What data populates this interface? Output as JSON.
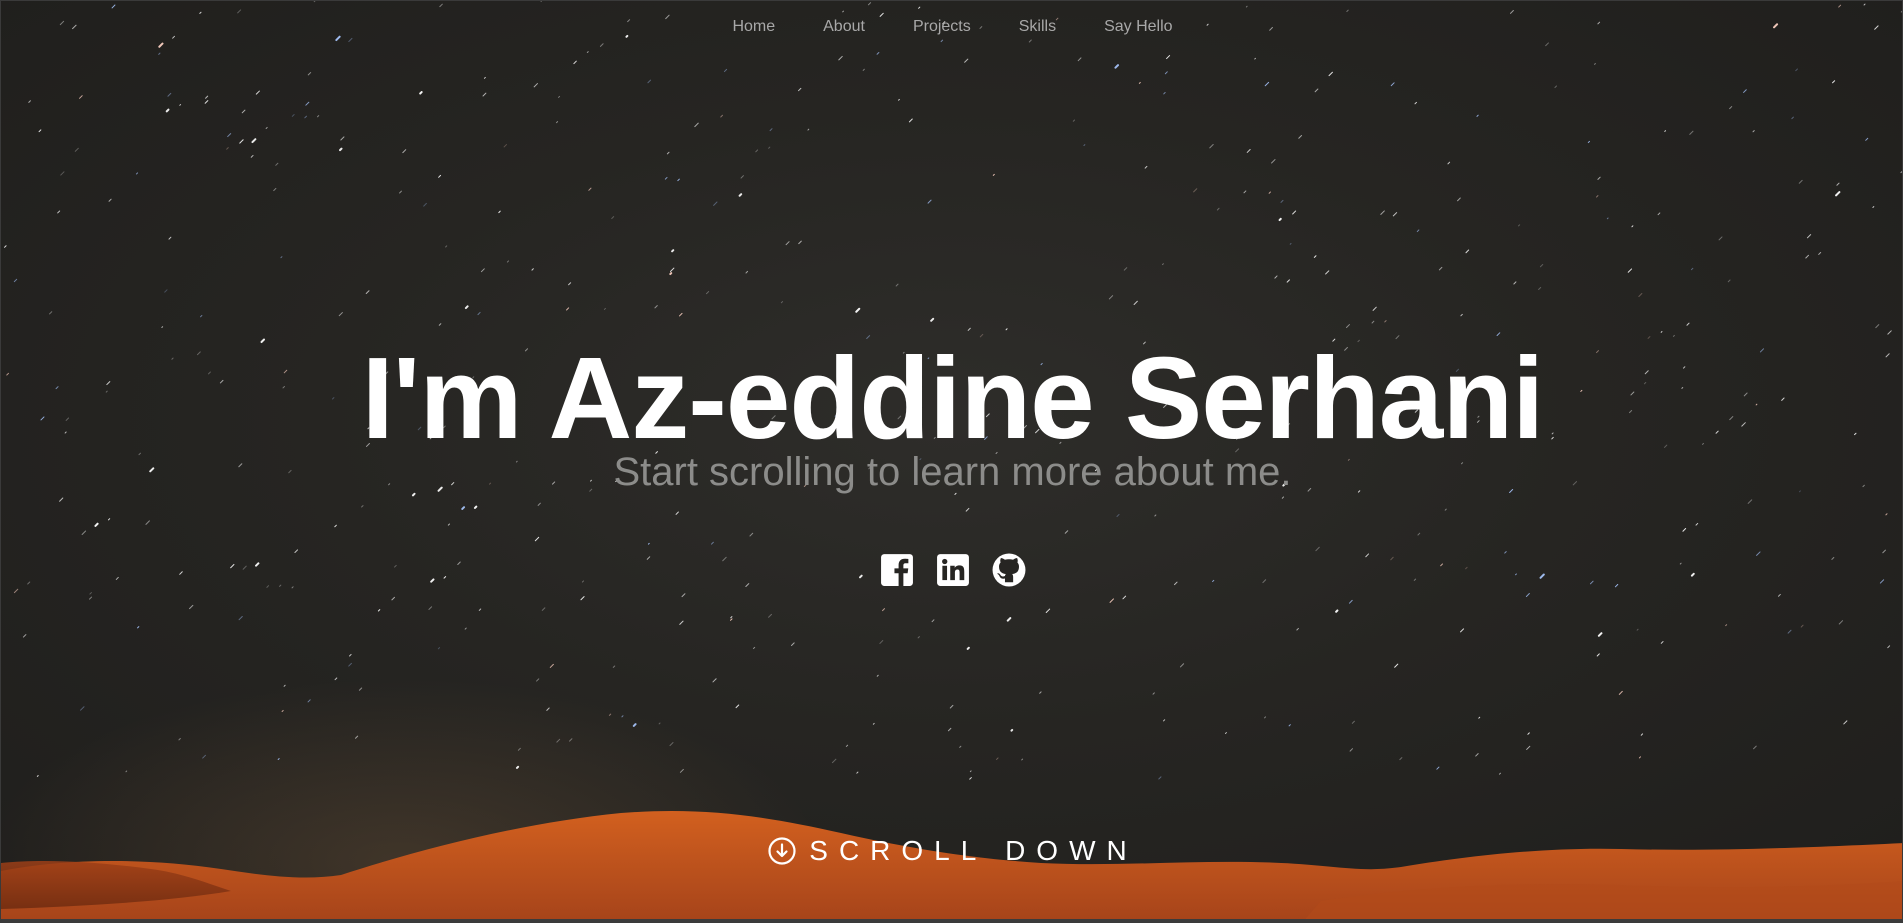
{
  "nav": {
    "items": [
      {
        "label": "Home"
      },
      {
        "label": "About"
      },
      {
        "label": "Projects"
      },
      {
        "label": "Skills"
      },
      {
        "label": "Say Hello"
      }
    ]
  },
  "hero": {
    "headline": "I'm Az-eddine Serhani",
    "subheadline": "Start scrolling to learn more about me.",
    "social": [
      {
        "icon": "facebook-icon"
      },
      {
        "icon": "linkedin-icon"
      },
      {
        "icon": "github-icon"
      }
    ],
    "scroll_label": "SCROLL DOWN",
    "scroll_icon": "arrow-down-circle-icon"
  },
  "colors": {
    "sky": "#262522",
    "dune": "#c4521c",
    "text": "#ffffff",
    "muted": "#8c8c8a"
  }
}
